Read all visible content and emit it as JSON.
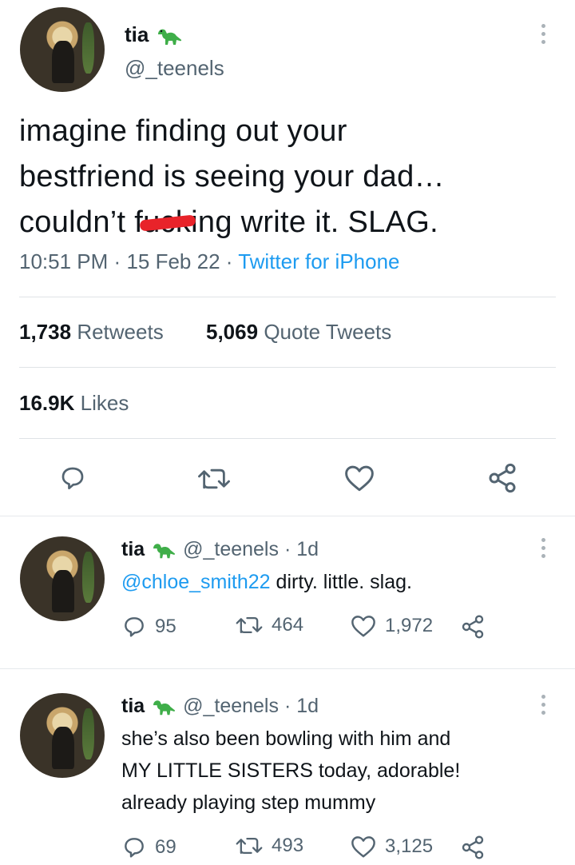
{
  "main_tweet": {
    "name": "tia",
    "handle": "@_teenels",
    "text_line1": "imagine finding out your",
    "text_line2": "bestfriend is seeing your dad…",
    "text_line3_a": "couldn’t f",
    "text_line3_censored": "u",
    "text_line3_mid": "ck",
    "text_line3_b": "ing write it. SLAG.",
    "time": "10:51 PM",
    "date": "15 Feb 22",
    "source": "Twitter for iPhone",
    "sep": "·",
    "retweets_count": "1,738",
    "retweets_label": "Retweets",
    "quotes_count": "5,069",
    "quotes_label": "Quote Tweets",
    "likes_count": "16.9K",
    "likes_label": "Likes"
  },
  "replies": [
    {
      "name": "tia",
      "handle": "@_teenels",
      "age": "· 1d",
      "mention": "@chloe_smith22",
      "text": " dirty. little. slag.",
      "replies": "95",
      "retweets": "464",
      "likes": "1,972"
    },
    {
      "name": "tia",
      "handle": "@_teenels",
      "age": "· 1d",
      "line1": "she’s also been bowling with him and",
      "line2": "MY LITTLE SISTERS today, adorable!",
      "line3": "already playing step mummy",
      "replies": "69",
      "retweets": "493",
      "likes": "3,125"
    }
  ],
  "icons": {
    "reply": "reply-icon",
    "retweet": "retweet-icon",
    "like": "heart-icon",
    "share": "share-icon",
    "more": "more-icon",
    "emoji": "dinosaur-emoji"
  },
  "colors": {
    "link": "#1d9bf0",
    "muted": "#536471",
    "text": "#0f1419",
    "censor": "#e8232a",
    "emoji": "#3fae49"
  }
}
